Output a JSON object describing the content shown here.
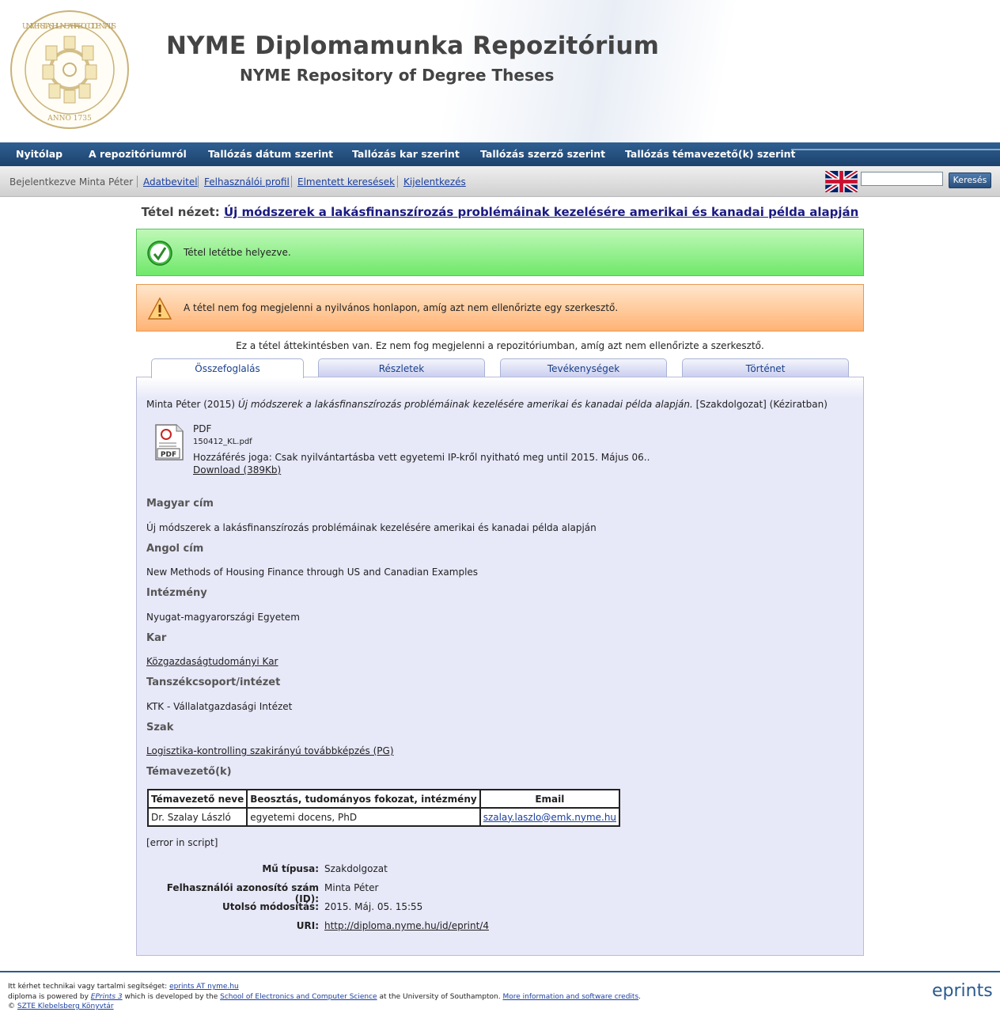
{
  "header": {
    "title": "NYME Diplomamunka Repozitórium",
    "subtitle": "NYME Repository of Degree Theses",
    "seal_text_top": "UNIVERSITAS HUNGARIAE OCCIDENTALIS",
    "seal_text_bottom": "ANNO 1735"
  },
  "mainnav": [
    "Nyitólap",
    "A repozitóriumról",
    "Tallózás dátum szerint",
    "Tallózás kar szerint",
    "Tallózás szerző szerint",
    "Tallózás témavezető(k) szerint"
  ],
  "userbar": {
    "logged_in": "Bejelentkezve Minta Péter",
    "links": [
      "Adatbevitel",
      "Felhasználói profil",
      "Elmentett keresések",
      "Kijelentkezés"
    ],
    "search_value": "",
    "search_button": "Keresés"
  },
  "item": {
    "heading_label": "Tétel nézet:",
    "heading_title": "Új módszerek a lakásfinanszírozás problémáinak kezelésére amerikai és kanadai példa alapján"
  },
  "messages": {
    "ok": "Tétel letétbe helyezve.",
    "warning": "A tétel nem fog megjelenni a nyilvános honlapon, amíg azt nem ellenőrizte egy szerkesztő.",
    "preview_note": "Ez a tétel áttekintésben van. Ez nem fog megjelenni a repozitóriumban, amíg azt nem ellenőrizte a szerkesztő."
  },
  "tabs": [
    "Összefoglalás",
    "Részletek",
    "Tevékenységek",
    "Történet"
  ],
  "summary": {
    "citation_author": "Minta Péter (2015)",
    "citation_title": "Új módszerek a lakásfinanszírozás problémáinak kezelésére amerikai és kanadai példa alapján.",
    "citation_suffix": "[Szakdolgozat] (Kéziratban)",
    "file_type": "PDF",
    "file_name": "150412_KL.pdf",
    "access": "Hozzáférés joga: Csak nyilvántartásba vett egyetemi IP-kről nyitható meg until 2015. Május 06..",
    "download": "Download (389Kb)",
    "icon_label": "PDF"
  },
  "fields": {
    "magyar_cim_label": "Magyar cím",
    "magyar_cim": "Új módszerek a lakásfinanszírozás problémáinak kezelésére amerikai és kanadai példa alapján",
    "angol_cim_label": "Angol cím",
    "angol_cim": "New Methods of Housing Finance through US and Canadian Examples",
    "intezmeny_label": "Intézmény",
    "intezmeny": "Nyugat-magyarországi Egyetem",
    "kar_label": "Kar",
    "kar": "Közgazdaságtudományi Kar",
    "tanszek_label": "Tanszékcsoport/intézet",
    "tanszek": "KTK - Vállalatgazdasági Intézet",
    "szak_label": "Szak",
    "szak": "Logisztika-kontrolling szakirányú továbbképzés (PG)",
    "temavezeto_label": "Témavezető(k)"
  },
  "supervisors": {
    "headers": [
      "Témavezető neve",
      "Beosztás, tudományos fokozat, intézmény",
      "Email"
    ],
    "rows": [
      [
        "Dr. Szalay László",
        "egyetemi docens, PhD",
        "szalay.laszlo@emk.nyme.hu"
      ]
    ]
  },
  "error_text": "[error in script]",
  "meta": {
    "type_label": "Mű típusa:",
    "type": "Szakdolgozat",
    "user_label": "Felhasználói azonosító szám (ID):",
    "user": "Minta Péter",
    "modified_label": "Utolsó módosítás:",
    "modified": "2015. Máj. 05. 15:55",
    "uri_label": "URI:",
    "uri": "http://diploma.nyme.hu/id/eprint/4"
  },
  "footer": {
    "line1_text": "Itt kérhet technikai vagy tartalmi segítséget:",
    "line1_link": "eprints AT nyme.hu",
    "line2_a": "diploma is powered by",
    "line2_eprints": "EPrints 3",
    "line2_b": "which is developed by the",
    "line2_school": "School of Electronics and Computer Science",
    "line2_c": "at the University of Southampton.",
    "line2_more": "More information and software credits",
    "line2_end": ".",
    "line3_copy": "©",
    "line3_link": "SZTE Klebelsberg Könyvtár",
    "logo_text": "eprints"
  },
  "colors": {
    "nav_bg": "#1c426d",
    "ok_bg": "#6fe86a",
    "warn_bg": "#ffb374",
    "panel_bg": "#e7e8f8",
    "link": "#1a3fa0"
  }
}
